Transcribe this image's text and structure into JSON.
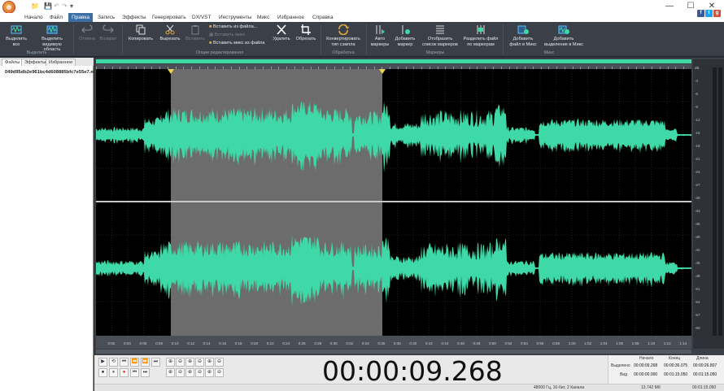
{
  "window": {
    "quick_access": [
      "📁",
      "💾",
      "↶",
      "↷",
      "▾"
    ],
    "controls": [
      "—",
      "☐",
      "✕"
    ]
  },
  "menu": {
    "tabs": [
      "Начало",
      "Файл",
      "Правка",
      "Запись",
      "Эффекты",
      "Генерировать",
      "DX/VST",
      "Инструменты",
      "Микс",
      "Избранное",
      "Справка"
    ],
    "active": "Правка",
    "social": [
      "f",
      "t",
      "g"
    ]
  },
  "ribbon": {
    "select_all": "Выделить все",
    "select_visible": "Выделить видимую область",
    "group_select": "Выделить",
    "undo": "Отмена",
    "redo": "Возврат",
    "copy": "Копировать",
    "cut": "Вырезать",
    "paste": "Вставить",
    "paste_from_file": "Вставить из файла...",
    "paste_mix": "Вставить микс",
    "paste_mix_from_file": "Вставить микс из файла",
    "group_edit": "Опции редактирования",
    "delete": "Удалить",
    "trim": "Обрезать",
    "convert": "Конвертировать тип сэмпла",
    "group_processing": "Обработка",
    "auto_markers": "Авто маркеры",
    "add_marker": "Добавить маркер",
    "show_markers": "Отобразить список маркеров",
    "split_file": "Разделить файл по маркерам",
    "group_markers": "Маркеры",
    "add_file_mix": "Добавить файл в Микс",
    "add_selection_mix": "Добавить выделение в Микс",
    "group_mix": "Микс"
  },
  "leftpanel": {
    "tabs": [
      "Файлы",
      "Эффекты",
      "Избранное"
    ],
    "file": "049d95db2e961bc4d608885bfc7e55e7.mp3"
  },
  "ruler": {
    "labels": [
      "0:02",
      "0:04",
      "0:06",
      "0:08",
      "0:10",
      "0:12",
      "0:14",
      "0:16",
      "0:18",
      "0:20",
      "0:22",
      "0:24",
      "0:26",
      "0:28",
      "0:30",
      "0:32",
      "0:34",
      "0:36",
      "0:38",
      "0:40",
      "0:42",
      "0:44",
      "0:46",
      "0:48",
      "0:50",
      "0:52",
      "0:54",
      "0:56",
      "0:58",
      "1:00",
      "1:02",
      "1:04",
      "1:06",
      "1:08",
      "1:10",
      "1:12",
      "1:14"
    ]
  },
  "levels": {
    "db": [
      "dB",
      "-3",
      "-6",
      "-9",
      "-12",
      "-15",
      "-18",
      "-21",
      "-24",
      "-27",
      "-30",
      "-33",
      "-36",
      "-39",
      "-42",
      "-45",
      "-48",
      "-51",
      "-54",
      "-57",
      "-60"
    ]
  },
  "transport": {
    "buttons_row1": [
      "▶",
      "⟲",
      "⏮",
      "⏪",
      "⏩",
      "⏭"
    ],
    "buttons_row2": [
      "⏹",
      "⏸",
      "●",
      "⏮",
      "⏭"
    ],
    "zoom_row1": [
      "⊕",
      "⊖",
      "⊕",
      "⊖",
      "⊕",
      "⊖"
    ],
    "zoom_row2": [
      "⊕",
      "⊖",
      "⊕",
      "⊖",
      "⊕",
      "⊖"
    ],
    "timecode": "00:00:09.268"
  },
  "timeinfo": {
    "headers": [
      "Начало",
      "Конец",
      "Длина"
    ],
    "selection_label": "Выделено",
    "view_label": "Вид",
    "selection": [
      "00:00:09.268",
      "00:00:36.075",
      "00:00:26.807"
    ],
    "view": [
      "00:00:00.000",
      "00:01:15.050",
      "00:01:15.050"
    ]
  },
  "status": {
    "format": "48000 Гц, 16-бит, 2 Канала",
    "size": "13.742 Мб",
    "duration": "00:01:15.050"
  },
  "colors": {
    "wave": "#3fd9a7",
    "selection": "#8a8a8a",
    "background": "#000000",
    "accent": "#3a6ea5"
  }
}
